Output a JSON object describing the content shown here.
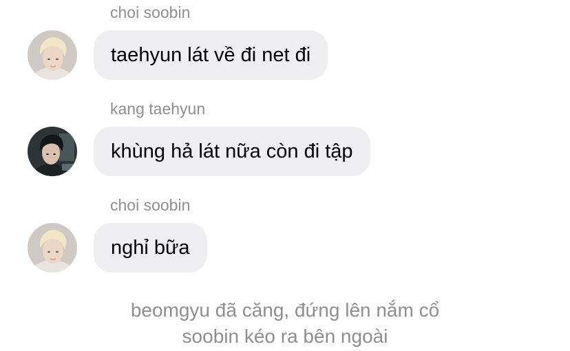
{
  "messages": [
    {
      "sender": "choi soobin",
      "text": "taehyun lát về đi net đi",
      "avatar_icon": "blond-person-avatar-icon"
    },
    {
      "sender": "kang taehyun",
      "text": "khùng hả lát nữa còn đi tập",
      "avatar_icon": "dark-hair-person-avatar-icon"
    },
    {
      "sender": "choi soobin",
      "text": "nghỉ bữa",
      "avatar_icon": "blond-person-avatar-icon"
    }
  ],
  "narration": {
    "line1": "beomgyu đã căng, đứng lên nắm cổ",
    "line2": "soobin kéo ra bên ngoài"
  },
  "colors": {
    "bubble_background": "#efeff1",
    "secondary_text": "#8e8e93",
    "message_text": "#000000"
  }
}
